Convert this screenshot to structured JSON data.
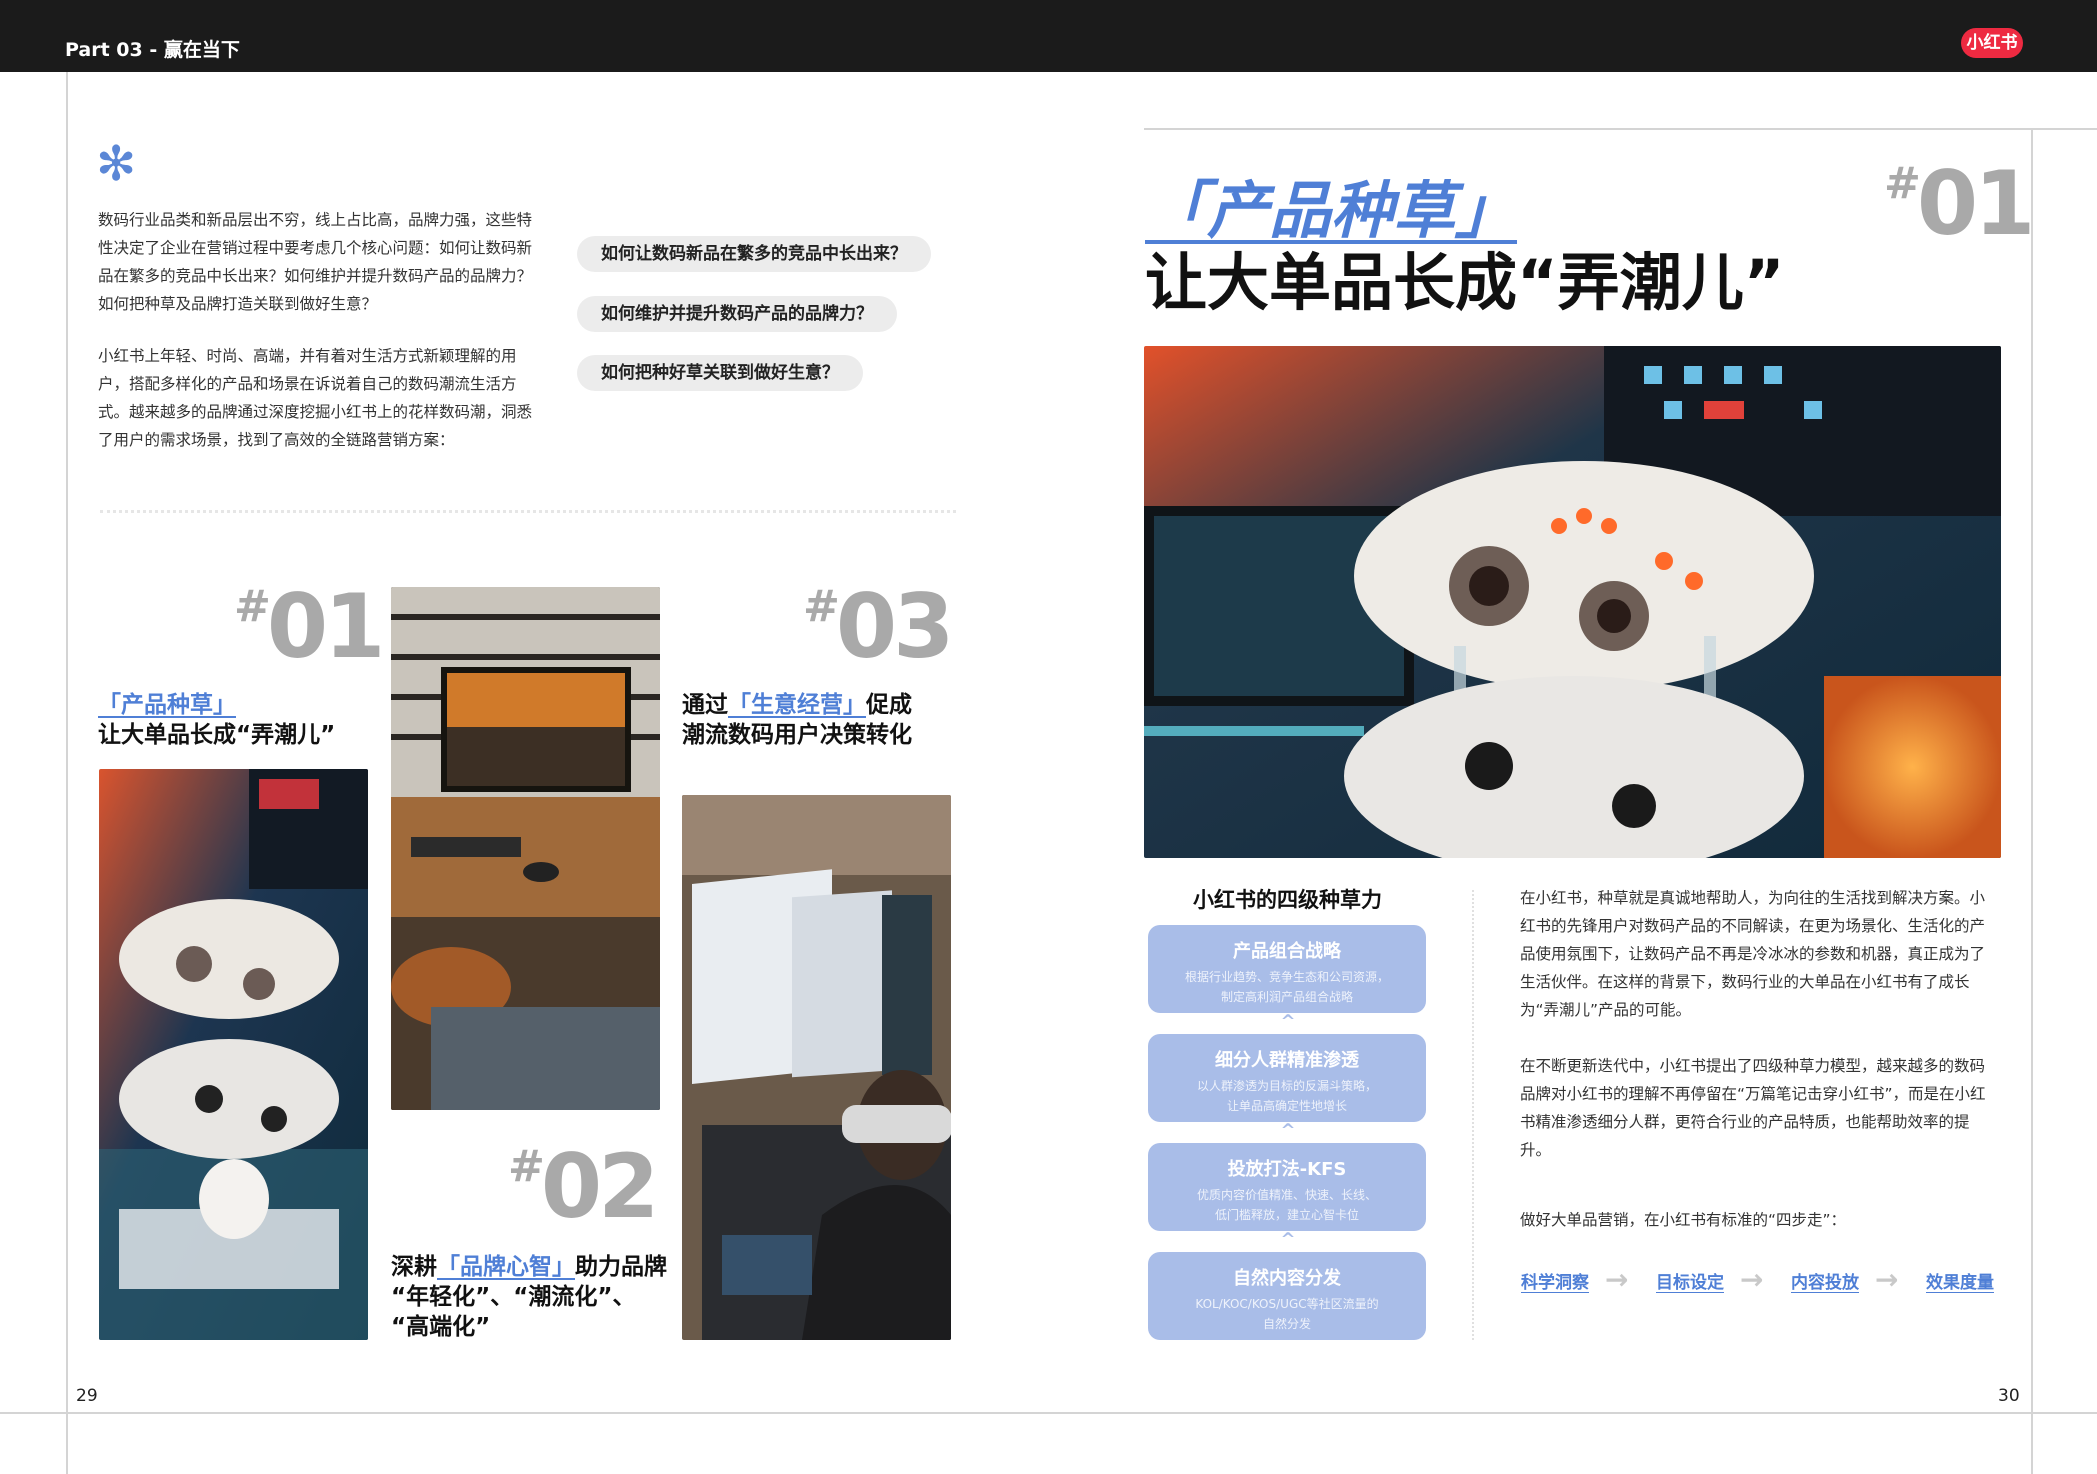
{
  "header": {
    "section": "Part 03 - 赢在当下",
    "logo": "小红书"
  },
  "left_page": {
    "intro_para1": "数码行业品类和新品层出不穷，线上占比高，品牌力强，这些特性决定了企业在营销过程中要考虑几个核心问题：如何让数码新品在繁多的竞品中长出来？如何维护并提升数码产品的品牌力？如何把种草及品牌打造关联到做好生意？",
    "intro_para2": "小红书上年轻、时尚、高端，并有着对生活方式新颖理解的用户，搭配多样化的产品和场景在诉说着自己的数码潮流生活方式。越来越多的品牌通过深度挖掘小红书上的花样数码潮，洞悉了用户的需求场景，找到了高效的全链路营销方案：",
    "questions": [
      "如何让数码新品在繁多的竞品中长出来？",
      "如何维护并提升数码产品的品牌力？",
      "如何把种好草关联到做好生意？"
    ],
    "item01": {
      "hash": "#",
      "num": "01",
      "kw": "「产品种草」",
      "line2": "让大单品长成“弄潮儿”"
    },
    "item02": {
      "hash": "#",
      "num": "02",
      "pre": "深耕",
      "kw": "「品牌心智」",
      "post": "助力品牌",
      "line2": "“年轻化”、“潮流化”、",
      "line3": "“高端化”"
    },
    "item03": {
      "hash": "#",
      "num": "03",
      "pre": "通过",
      "kw": "「生意经营」",
      "post": "促成",
      "line2": "潮流数码用户决策转化"
    },
    "page_number": "29"
  },
  "right_page": {
    "hash": "#",
    "num": "01",
    "title_kw": "「产品种草」",
    "title_line2": "让大单品长成“弄潮儿”",
    "model_title": "小红书的四级种草力",
    "tiers": [
      {
        "title": "产品组合战略",
        "desc1": "根据行业趋势、竞争生态和公司资源，",
        "desc2": "制定高利润产品组合战略"
      },
      {
        "title": "细分人群精准渗透",
        "desc1": "以人群渗透为目标的反漏斗策略，",
        "desc2": "让单品高确定性地增长"
      },
      {
        "title": "投放打法-KFS",
        "desc1": "优质内容价值精准、快速、长线、",
        "desc2": "低门槛释放，建立心智卡位"
      },
      {
        "title": "自然内容分发",
        "desc1": "KOL/KOC/KOS/UGC等社区流量的",
        "desc2": "自然分发"
      }
    ],
    "para1": "在小红书，种草就是真诚地帮助人，为向往的生活找到解决方案。小红书的先锋用户对数码产品的不同解读，在更为场景化、生活化的产品使用氛围下，让数码产品不再是冷冰冰的参数和机器，真正成为了生活伙伴。在这样的背景下，数码行业的大单品在小红书有了成长为“弄潮儿”产品的可能。",
    "para2": "在不断更新迭代中，小红书提出了四级种草力模型，越来越多的数码品牌对小红书的理解不再停留在“万篇笔记击穿小红书”，而是在小红书精准渗透细分人群，更符合行业的产品特质，也能帮助效率的提升。",
    "para3": "做好大单品营销，在小红书有标准的“四步走”：",
    "steps": [
      "科学洞察",
      "目标设定",
      "内容投放",
      "效果度量"
    ],
    "page_number": "30"
  }
}
